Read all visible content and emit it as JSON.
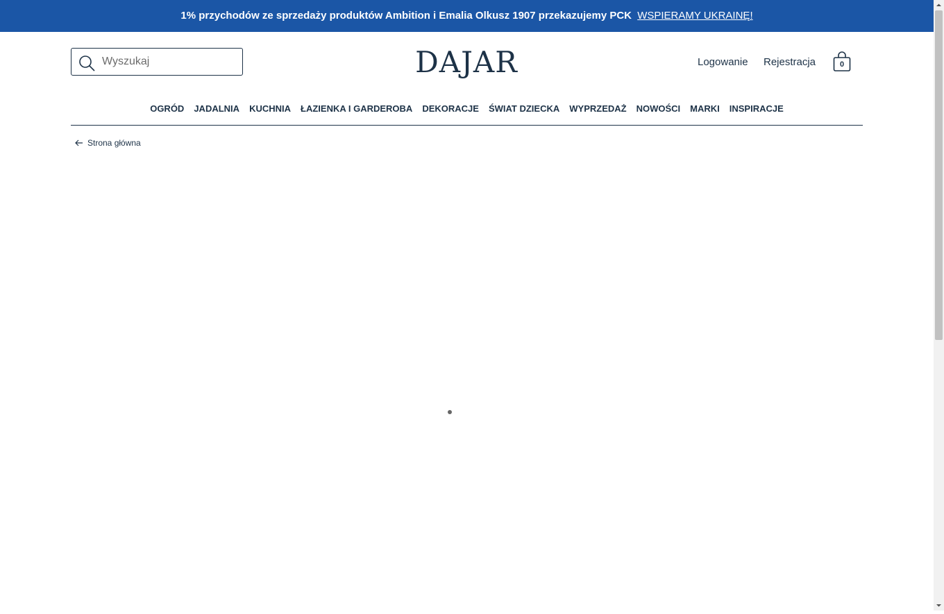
{
  "announcement": {
    "text": "1% przychodów ze sprzedaży produktów Ambition i Emalia Olkusz 1907 przekazujemy PCK",
    "link_label": "WSPIERAMY UKRAINĘ!"
  },
  "search": {
    "placeholder": "Wyszukaj"
  },
  "logo": {
    "text": "DAJAR"
  },
  "account": {
    "login_label": "Logowanie",
    "register_label": "Rejestracja"
  },
  "cart": {
    "count": "0"
  },
  "nav": {
    "items": [
      "OGRÓD",
      "JADALNIA",
      "KUCHNIA",
      "ŁAZIENKA I GARDEROBA",
      "DEKORACJE",
      "ŚWIAT DZIECKA",
      "WYPRZEDAŻ",
      "NOWOŚCI",
      "MARKI",
      "INSPIRACJE"
    ]
  },
  "breadcrumb": {
    "label": "Strona główna"
  },
  "colors": {
    "announcement_bg": "#1b56a6",
    "text": "#1d3247"
  }
}
